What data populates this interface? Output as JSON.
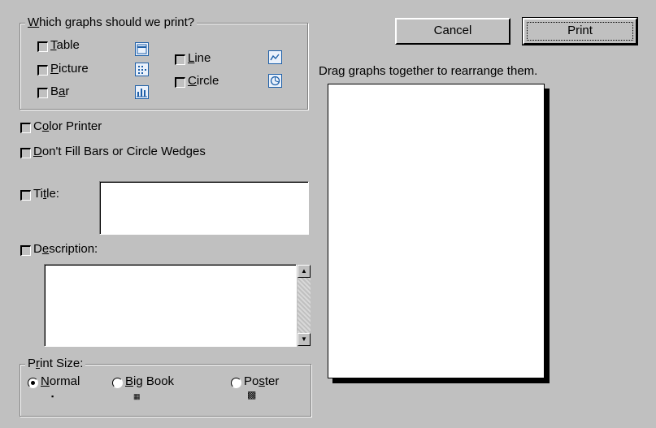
{
  "graphs_group": {
    "legend_prefix": "W",
    "legend_rest": "hich graphs should we print?",
    "table": {
      "u": "T",
      "rest": "able",
      "icon": "table-graph-icon"
    },
    "picture": {
      "u": "P",
      "rest": "icture",
      "icon": "picture-graph-icon"
    },
    "bar": {
      "pre": "B",
      "u": "a",
      "rest": "r",
      "icon": "bar-graph-icon"
    },
    "line": {
      "u": "L",
      "rest": "ine",
      "icon": "line-graph-icon"
    },
    "circle": {
      "u": "C",
      "rest": "ircle",
      "icon": "circle-graph-icon"
    }
  },
  "color_printer": {
    "pre": "C",
    "u": "o",
    "rest": "lor Printer"
  },
  "dont_fill": {
    "u": "D",
    "rest": "on't Fill Bars or Circle Wedges"
  },
  "title_option": {
    "pre": "Ti",
    "u": "t",
    "rest": "le:",
    "value": ""
  },
  "description_option": {
    "pre": "D",
    "u": "e",
    "rest": "scription:",
    "value": ""
  },
  "print_size": {
    "legend_pre": "P",
    "legend_u": "r",
    "legend_rest": "int Size:",
    "normal": {
      "u": "N",
      "rest": "ormal",
      "selected": true
    },
    "big_book": {
      "u": "B",
      "rest": "ig Book",
      "selected": false
    },
    "poster": {
      "pre": "Po",
      "u": "s",
      "rest": "ter",
      "selected": false
    }
  },
  "buttons": {
    "cancel": "Cancel",
    "print": "Print"
  },
  "preview": {
    "instruction": "Drag graphs together to rearrange them."
  }
}
